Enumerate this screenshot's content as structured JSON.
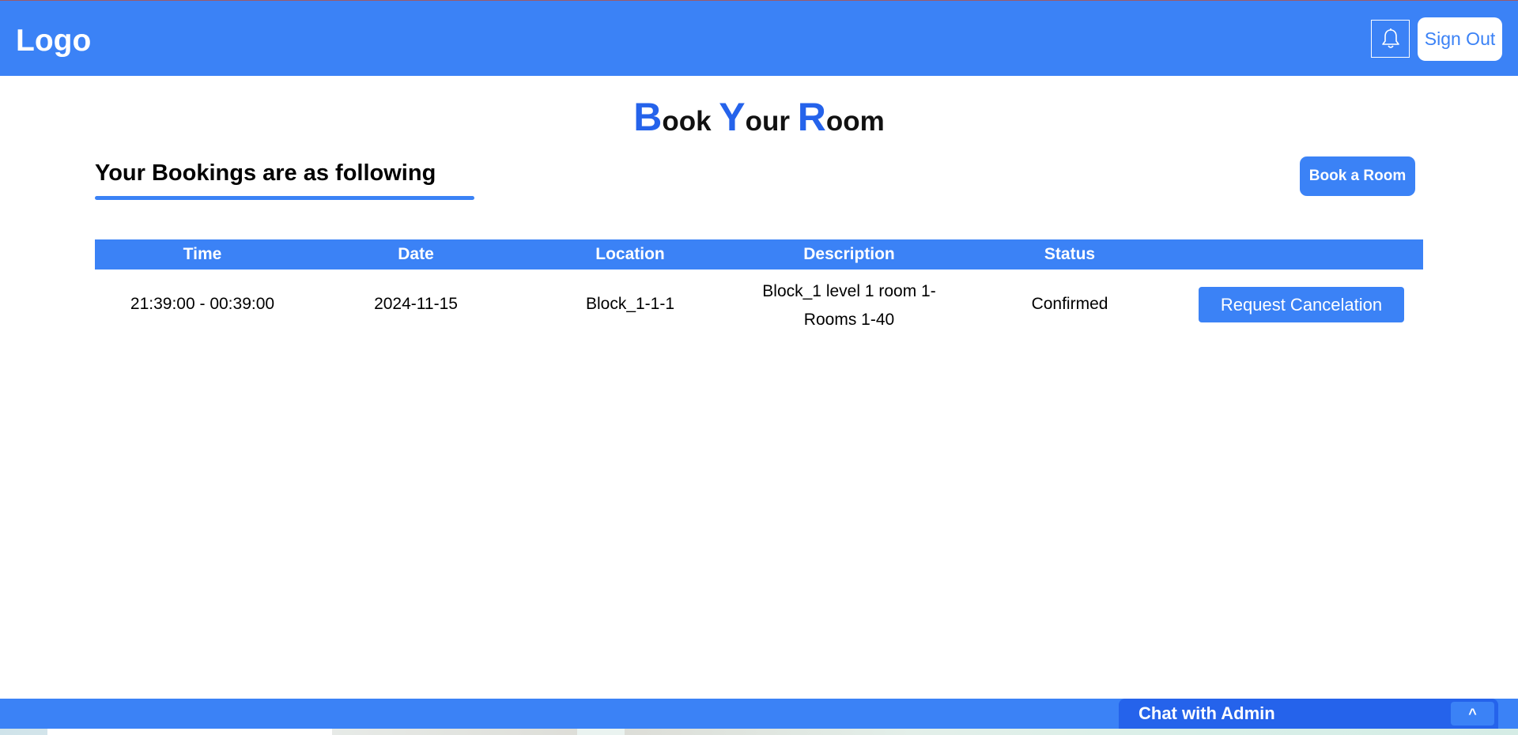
{
  "navbar": {
    "logo": "Logo",
    "sign_out_label": "Sign Out",
    "accent_color": "#3b82f6"
  },
  "page": {
    "title_parts": [
      {
        "cap": "B",
        "rest": "ook"
      },
      {
        "cap": "Y",
        "rest": "our"
      },
      {
        "cap": "R",
        "rest": "oom"
      }
    ],
    "section_heading": "Your Bookings are as following",
    "book_button_label": "Book a Room"
  },
  "table": {
    "headers": [
      "Time",
      "Date",
      "Location",
      "Description",
      "Status"
    ],
    "rows": [
      {
        "time": "21:39:00 - 00:39:00",
        "date": "2024-11-15",
        "location": "Block_1-1-1",
        "description": "Block_1 level 1 room 1- Rooms 1-40",
        "status": "Confirmed",
        "action_label": "Request Cancelation"
      }
    ]
  },
  "chat": {
    "label": "Chat with Admin",
    "toggle_label": "^"
  },
  "icons": {
    "notification": "bell-icon"
  }
}
